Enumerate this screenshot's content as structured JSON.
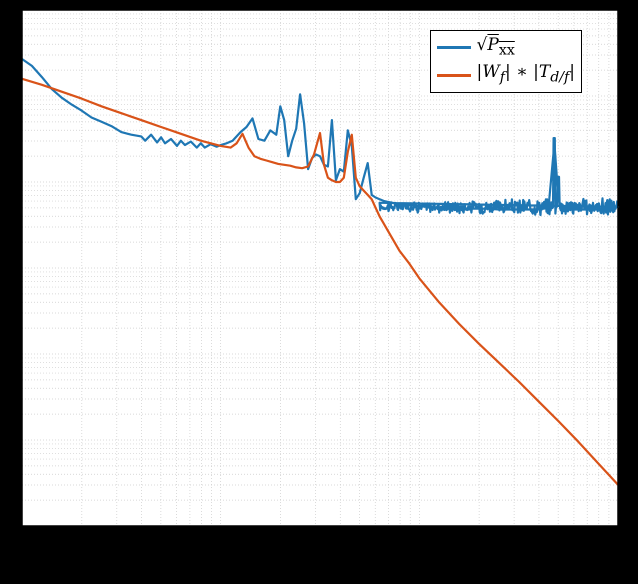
{
  "chart_data": {
    "type": "line",
    "axes": {
      "x": {
        "scale": "log",
        "range_decades": [
          0,
          3
        ],
        "gridlines_at_decades": [
          0,
          1,
          2,
          3
        ]
      },
      "y": {
        "scale": "log",
        "range_decades": [
          0,
          6
        ],
        "gridlines_at_decades": [
          0,
          1,
          2,
          3,
          4,
          5,
          6
        ]
      }
    },
    "series": [
      {
        "name": "sqrt(Pxx)",
        "legend_html": "√<span class='sqrt-over'>P<sub>xx</sub></span>",
        "color": "#1f77b4",
        "x_log": [
          0.0,
          0.05,
          0.1,
          0.15,
          0.2,
          0.25,
          0.3,
          0.35,
          0.4,
          0.45,
          0.5,
          0.55,
          0.6,
          0.62,
          0.65,
          0.68,
          0.7,
          0.72,
          0.75,
          0.78,
          0.8,
          0.82,
          0.85,
          0.88,
          0.9,
          0.92,
          0.95,
          0.98,
          1.0,
          1.03,
          1.06,
          1.1,
          1.13,
          1.16,
          1.19,
          1.22,
          1.25,
          1.28,
          1.3,
          1.32,
          1.34,
          1.36,
          1.38,
          1.4,
          1.42,
          1.44,
          1.46,
          1.48,
          1.5,
          1.52,
          1.54,
          1.56,
          1.58,
          1.6,
          1.62,
          1.64,
          1.66,
          1.68,
          1.7,
          1.72,
          1.74,
          1.76,
          1.78,
          1.8,
          1.82,
          1.84,
          1.86,
          1.88,
          1.9,
          1.95,
          2.0,
          2.05,
          2.1,
          2.15,
          2.2,
          2.25,
          2.3,
          2.35,
          2.4,
          2.45,
          2.5,
          2.55,
          2.6,
          2.65,
          2.68,
          2.7,
          2.72,
          2.75,
          2.8,
          2.85,
          2.9,
          2.95,
          3.0
        ],
        "y_log": [
          5.43,
          5.35,
          5.22,
          5.08,
          4.98,
          4.9,
          4.83,
          4.75,
          4.7,
          4.65,
          4.58,
          4.55,
          4.53,
          4.48,
          4.55,
          4.46,
          4.52,
          4.45,
          4.5,
          4.42,
          4.48,
          4.43,
          4.47,
          4.4,
          4.45,
          4.4,
          4.44,
          4.41,
          4.43,
          4.45,
          4.48,
          4.58,
          4.64,
          4.74,
          4.5,
          4.48,
          4.6,
          4.55,
          4.88,
          4.72,
          4.3,
          4.48,
          4.62,
          5.02,
          4.68,
          4.15,
          4.28,
          4.32,
          4.3,
          4.2,
          4.18,
          4.72,
          4.02,
          4.15,
          4.12,
          4.6,
          4.42,
          3.8,
          3.87,
          4.05,
          4.22,
          3.85,
          3.82,
          3.8,
          3.78,
          3.77,
          3.76,
          3.75,
          3.74,
          3.73,
          3.72,
          3.71,
          3.7,
          3.7,
          3.7,
          3.69,
          3.69,
          3.69,
          3.68,
          3.68,
          3.68,
          3.68,
          3.68,
          3.7,
          4.45,
          3.8,
          3.68,
          3.68,
          3.68,
          3.68,
          3.68,
          3.7,
          3.71
        ],
        "noise_from_x": 1.8,
        "noise_amp": 0.16
      },
      {
        "name": "|Wf| * |Td/f|",
        "legend_html": "|W<sub>f</sub>|&nbsp;∗&nbsp;|T<sub>d/f</sub>|",
        "color": "#d95319",
        "x_log": [
          0.0,
          0.1,
          0.2,
          0.3,
          0.4,
          0.5,
          0.6,
          0.7,
          0.8,
          0.9,
          1.0,
          1.05,
          1.08,
          1.11,
          1.14,
          1.17,
          1.2,
          1.23,
          1.26,
          1.29,
          1.32,
          1.35,
          1.38,
          1.41,
          1.44,
          1.47,
          1.5,
          1.52,
          1.54,
          1.56,
          1.58,
          1.6,
          1.62,
          1.64,
          1.66,
          1.68,
          1.7,
          1.72,
          1.74,
          1.76,
          1.78,
          1.8,
          1.85,
          1.9,
          1.95,
          2.0,
          2.1,
          2.2,
          2.3,
          2.4,
          2.5,
          2.6,
          2.7,
          2.8,
          2.9,
          3.0
        ],
        "y_log": [
          5.2,
          5.13,
          5.05,
          4.97,
          4.88,
          4.8,
          4.72,
          4.64,
          4.56,
          4.48,
          4.42,
          4.4,
          4.45,
          4.56,
          4.4,
          4.3,
          4.27,
          4.25,
          4.23,
          4.21,
          4.2,
          4.19,
          4.17,
          4.16,
          4.18,
          4.32,
          4.57,
          4.2,
          4.05,
          4.02,
          4.0,
          4.0,
          4.05,
          4.35,
          4.55,
          4.05,
          3.95,
          3.9,
          3.85,
          3.8,
          3.7,
          3.6,
          3.4,
          3.2,
          3.05,
          2.88,
          2.6,
          2.35,
          2.12,
          1.9,
          1.68,
          1.45,
          1.22,
          0.98,
          0.73,
          0.48
        ]
      }
    ],
    "legend": {
      "position": "upper-right"
    }
  },
  "legend_labels": {
    "pxx": "√Pxx",
    "wf": "|Wf| ∗ |Td/f|"
  }
}
